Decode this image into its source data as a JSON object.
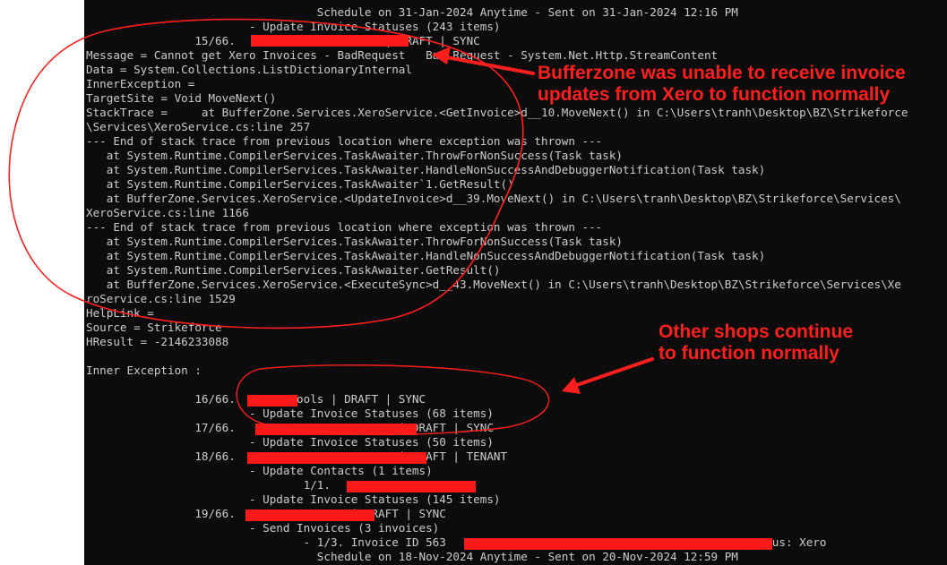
{
  "console": {
    "lines": [
      "                                  Schedule on 31-Jan-2024 Anytime - Sent on 31-Jan-2024 12:16 PM",
      "                        - Update Invoice Statuses (243 items)",
      "                15/66.                      | DRAFT | SYNC",
      "Message = Cannot get Xero Invoices - BadRequest   Bad Request - System.Net.Http.StreamContent",
      "Data = System.Collections.ListDictionaryInternal",
      "InnerException =",
      "TargetSite = Void MoveNext()",
      "StackTrace =     at BufferZone.Services.XeroService.<GetInvoice>d__10.MoveNext() in C:\\Users\\tranh\\Desktop\\BZ\\Strikeforce",
      "\\Services\\XeroService.cs:line 257",
      "--- End of stack trace from previous location where exception was thrown ---",
      "   at System.Runtime.CompilerServices.TaskAwaiter.ThrowForNonSuccess(Task task)",
      "   at System.Runtime.CompilerServices.TaskAwaiter.HandleNonSuccessAndDebuggerNotification(Task task)",
      "   at System.Runtime.CompilerServices.TaskAwaiter`1.GetResult()",
      "   at BufferZone.Services.XeroService.<UpdateInvoice>d__39.MoveNext() in C:\\Users\\tranh\\Desktop\\BZ\\Strikeforce\\Services\\",
      "XeroService.cs:line 1166",
      "--- End of stack trace from previous location where exception was thrown ---",
      "   at System.Runtime.CompilerServices.TaskAwaiter.ThrowForNonSuccess(Task task)",
      "   at System.Runtime.CompilerServices.TaskAwaiter.HandleNonSuccessAndDebuggerNotification(Task task)",
      "   at System.Runtime.CompilerServices.TaskAwaiter.GetResult()",
      "   at BufferZone.Services.XeroService.<ExecuteSync>d__43.MoveNext() in C:\\Users\\tranh\\Desktop\\BZ\\Strikeforce\\Services\\Xe",
      "roService.cs:line 1529",
      "HelpLink =",
      "Source = Strikeforce",
      "HResult = -2146233088",
      "",
      "Inner Exception :",
      "",
      "                16/66.        Pools | DRAFT | SYNC",
      "                        - Update Invoice Statuses (68 items)",
      "                17/66.                        | DRAFT | SYNC",
      "                        - Update Invoice Statuses (50 items)",
      "                18/66.                        | DRAFT | TENANT",
      "                        - Update Contacts (1 items)",
      "                                1/1.",
      "                        - Update Invoice Statuses (145 items)",
      "                19/66.                 | DRAFT | SYNC",
      "                        - Send Invoices (3 invoices)",
      "                                - 1/3. Invoice ID 563                                       AU - Status: Xero",
      "                                  Schedule on 18-Nov-2024 Anytime - Sent on 20-Nov-2024 12:59 PM"
    ]
  },
  "annotations": {
    "top_note": "Bufferzone was unable to receive invoice\nupdates from Xero to function normally",
    "bottom_note": "Other shops continue\nto function normally",
    "color": "#ff1f1f"
  },
  "colors": {
    "console_bg": "#0c0c0c",
    "console_text": "#cccccc",
    "redaction": "#ff1a1a"
  }
}
